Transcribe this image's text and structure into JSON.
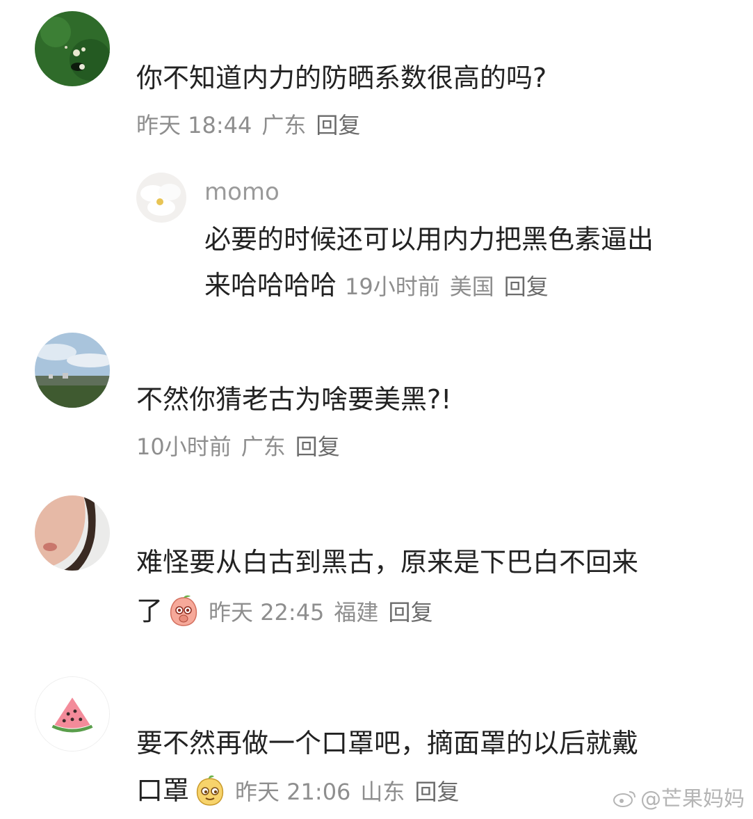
{
  "comments": [
    {
      "text": "你不知道内力的防晒系数很高的吗?",
      "time": "昨天 18:44",
      "location": "广东",
      "reply_label": "回复",
      "avatar_icon": "green-leaf-avatar",
      "replies": [
        {
          "username": "momo",
          "text_line1": "必要的时候还可以用内力把黑色素逼出",
          "text_line2": "来哈哈哈哈",
          "time": "19小时前",
          "location": "美国",
          "reply_label": "回复",
          "avatar_icon": "white-flower-avatar"
        }
      ]
    },
    {
      "text": "不然你猜老古为啥要美黑?!",
      "time": "10小时前",
      "location": "广东",
      "reply_label": "回复",
      "avatar_icon": "sky-landscape-avatar"
    },
    {
      "text_line1": "难怪要从白古到黑古，原来是下巴白不回来",
      "text_line2": "了",
      "emoji": "shy-peach-emoji",
      "time": "昨天 22:45",
      "location": "福建",
      "reply_label": "回复",
      "avatar_icon": "face-photo-avatar"
    },
    {
      "text_line1": "要不然再做一个口罩吧，摘面罩的以后就戴",
      "text_line2": "口罩",
      "emoji": "smug-face-emoji",
      "time": "昨天 21:06",
      "location": "山东",
      "reply_label": "回复",
      "avatar_icon": "watermelon-avatar"
    }
  ],
  "watermark": {
    "text": "@芒果妈妈",
    "icon": "weibo-icon"
  }
}
